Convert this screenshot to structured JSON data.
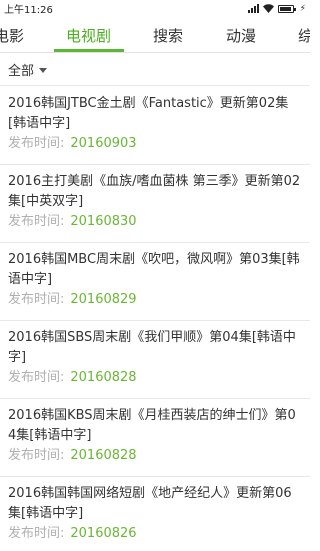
{
  "status_bar": {
    "time": "上午11:26"
  },
  "tabs": [
    {
      "label": "电影",
      "active": false
    },
    {
      "label": "电视剧",
      "active": true
    },
    {
      "label": "搜索",
      "active": false
    },
    {
      "label": "动漫",
      "active": false
    },
    {
      "label": "综",
      "active": false
    }
  ],
  "filter": {
    "label": "全部"
  },
  "meta_label": "发布时间:",
  "items": [
    {
      "title": "2016韩国JTBC金土剧《Fantastic》更新第02集[韩语中字]",
      "date": "20160903"
    },
    {
      "title": "2016主打美剧《血族/嗜血菌株 第三季》更新第02集[中英双字]",
      "date": "20160830"
    },
    {
      "title": "2016韩国MBC周末剧《吹吧，微风啊》第03集[韩语中字]",
      "date": "20160829"
    },
    {
      "title": "2016韩国SBS周末剧《我们甲顺》第04集[韩语中字]",
      "date": "20160828"
    },
    {
      "title": "2016韩国KBS周末剧《月桂西装店的绅士们》第04集[韩语中字]",
      "date": "20160828"
    },
    {
      "title": "2016韩国韩国网络短剧《地产经纪人》更新第06集[韩语中字]",
      "date": "20160826"
    }
  ],
  "colors": {
    "accent": "#5bb834",
    "date": "#6ab734",
    "muted": "#b0b0b0"
  }
}
